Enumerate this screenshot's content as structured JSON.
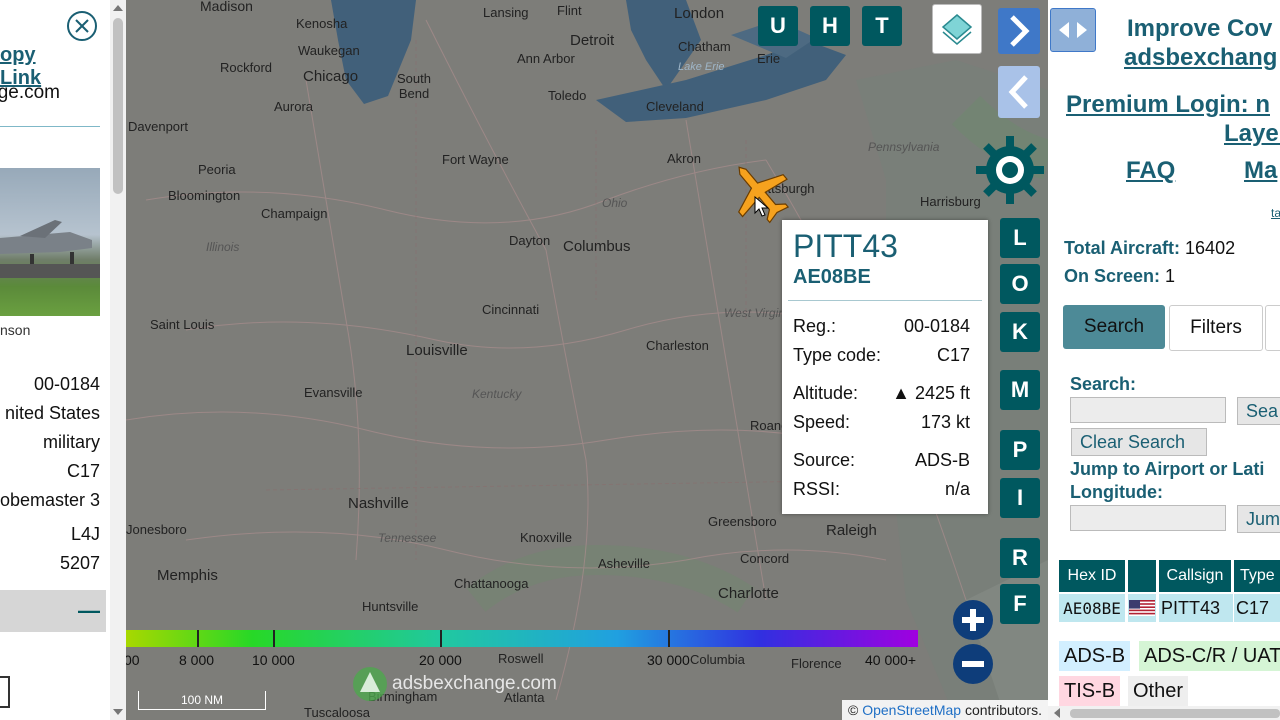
{
  "left_panel": {
    "copy_link": "opy Link",
    "domain": "ge.com",
    "photo_credit": "nson",
    "details": [
      "00-0184",
      "nited States",
      "military",
      "C17",
      "obemaster 3",
      "L4J",
      "5207"
    ],
    "collapse_symbol": "—"
  },
  "map": {
    "cities": [
      "Madison",
      "Kenosha",
      "Waukegan",
      "Rockford",
      "Chicago",
      "Aurora",
      "South Bend",
      "Lansing",
      "Flint",
      "Detroit",
      "Ann Arbor",
      "Toledo",
      "London",
      "Chatham",
      "Erie",
      "Cleveland",
      "Akron",
      "Fort Wayne",
      "Davenport",
      "Peoria",
      "Bloomington",
      "Champaign",
      "Dayton",
      "Columbus",
      "Pittsburgh",
      "Harrisburg",
      "Cincinnati",
      "Saint Louis",
      "Louisville",
      "Charleston",
      "Evansville",
      "Roanoke",
      "Nashville",
      "Knoxville",
      "Greensboro",
      "Raleigh",
      "Concord",
      "Charlotte",
      "Asheville",
      "Chattanooga",
      "Memphis",
      "Huntsville",
      "Birmingham",
      "Atlanta",
      "Roswell",
      "Columbia",
      "Florence",
      "Tuscaloosa",
      "Jonesboro"
    ],
    "regions": [
      "Illinois",
      "Ohio",
      "Kentucky",
      "Tennessee",
      "West Virginia",
      "Pennsylvania",
      "Lake Erie"
    ],
    "mode_buttons": [
      "U",
      "H",
      "T"
    ],
    "side_buttons": [
      "L",
      "O",
      "K",
      "M",
      "P",
      "I",
      "R",
      "F"
    ],
    "scale_bar": {
      "ticks": [
        "00",
        "8 000",
        "10 000",
        "20 000",
        "30 000",
        "40 000+"
      ],
      "colors": [
        "#a8d800",
        "#27d827",
        "#20c8a0",
        "#20a0e0",
        "#3030e0",
        "#a000e0"
      ]
    },
    "scale_distance": "100 NM",
    "watermark": "adsbexchange.com",
    "attribution_symbol": "©",
    "attribution_link": "OpenStreetMap",
    "attribution_suffix": "contributors."
  },
  "popup": {
    "callsign": "PITT43",
    "hex": "AE08BE",
    "rows": [
      {
        "label": "Reg.:",
        "value": "00-0184"
      },
      {
        "label": "Type code:",
        "value": "C17"
      },
      {
        "label": "Altitude:",
        "value": "▲ 2425 ft"
      },
      {
        "label": "Speed:",
        "value": "173 kt"
      },
      {
        "label": "Source:",
        "value": "ADS-B"
      },
      {
        "label": "RSSI:",
        "value": "n/a"
      }
    ]
  },
  "right_panel": {
    "improve_line1": "Improve Cov",
    "improve_line2": "adsbexchang",
    "premium_line1": "Premium Login: n",
    "premium_line2": "Layer",
    "faq": "FAQ",
    "map_link": "Ma",
    "small_link": "ta",
    "total_label": "Total Aircraft:",
    "total_value": "16402",
    "onscreen_label": "On Screen:",
    "onscreen_value": "1",
    "tabs": [
      "Search",
      "Filters"
    ],
    "search_label": "Search:",
    "search_button": "Sea",
    "clear_search": "Clear Search",
    "jump_label_1": "Jump to Airport or Lati",
    "jump_label_2": "Longitude:",
    "jump_button": "Jum",
    "table_headers": [
      "Hex ID",
      "",
      "Callsign",
      "Type"
    ],
    "table_row": {
      "hex": "AE08BE",
      "callsign": "PITT43",
      "type": "C17"
    },
    "legend": {
      "adsb": "ADS-B",
      "adsc": "ADS-C/R / UAT",
      "tisb": "TIS-B",
      "other": "Other"
    },
    "colors": {
      "adsb": "#d2efff",
      "adsc": "#d5f5d5",
      "tisb": "#ffd7e1",
      "other": "#eeeeee"
    }
  }
}
